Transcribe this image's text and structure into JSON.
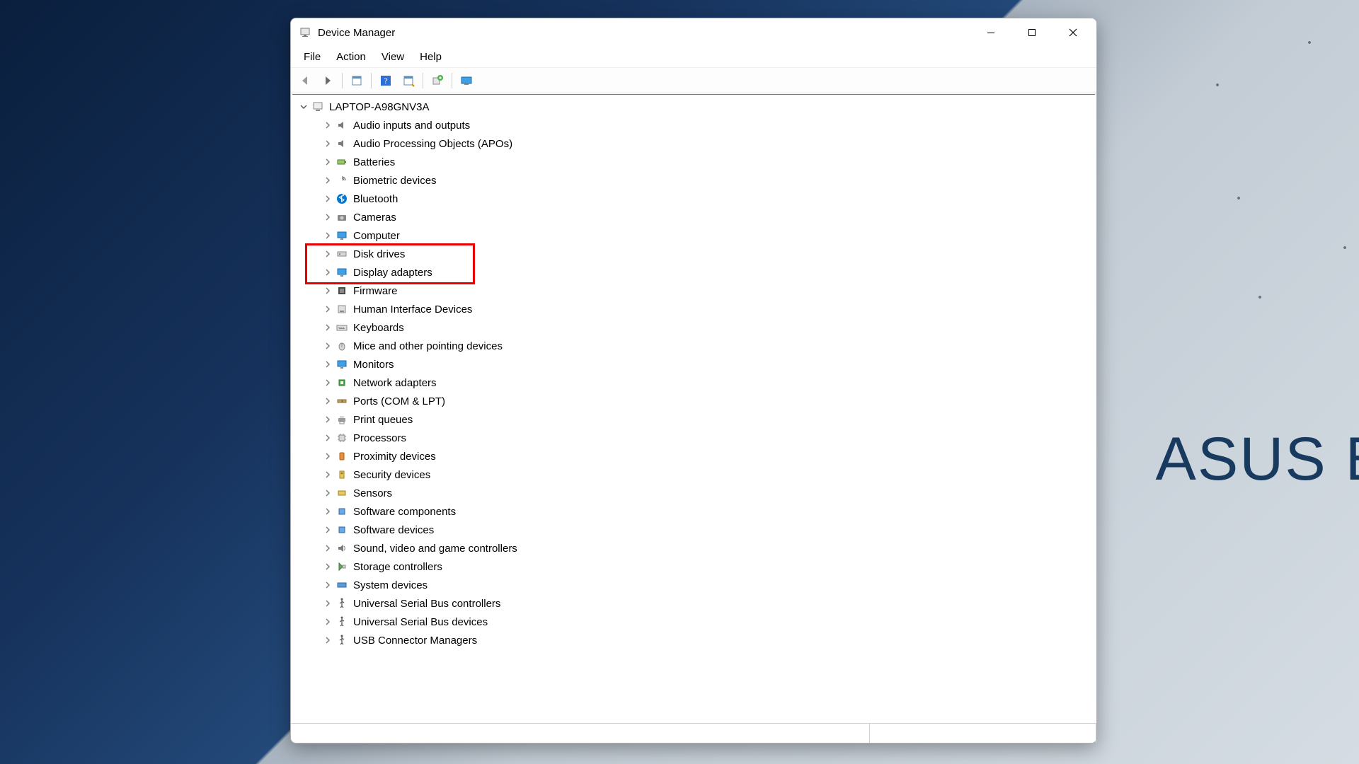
{
  "desktop": {
    "brand_text": "ASUS E"
  },
  "window": {
    "title": "Device Manager",
    "menu": {
      "file": "File",
      "action": "Action",
      "view": "View",
      "help": "Help"
    },
    "toolbar": {
      "back": "back-icon",
      "forward": "forward-icon",
      "show_hidden": "show-hidden-icon",
      "help": "help-icon",
      "properties": "properties-icon",
      "update": "update-driver-icon",
      "scan": "scan-hardware-icon"
    }
  },
  "tree": {
    "root": {
      "label": "LAPTOP-A98GNV3A",
      "expanded": true
    },
    "items": [
      {
        "label": "Audio inputs and outputs",
        "icon": "audio-icon"
      },
      {
        "label": "Audio Processing Objects (APOs)",
        "icon": "audio-icon"
      },
      {
        "label": "Batteries",
        "icon": "battery-icon"
      },
      {
        "label": "Biometric devices",
        "icon": "biometric-icon"
      },
      {
        "label": "Bluetooth",
        "icon": "bluetooth-icon"
      },
      {
        "label": "Cameras",
        "icon": "camera-icon"
      },
      {
        "label": "Computer",
        "icon": "computer-icon"
      },
      {
        "label": "Disk drives",
        "icon": "disk-icon",
        "highlight": true
      },
      {
        "label": "Display adapters",
        "icon": "display-icon",
        "highlight": true
      },
      {
        "label": "Firmware",
        "icon": "firmware-icon"
      },
      {
        "label": "Human Interface Devices",
        "icon": "hid-icon"
      },
      {
        "label": "Keyboards",
        "icon": "keyboard-icon"
      },
      {
        "label": "Mice and other pointing devices",
        "icon": "mouse-icon"
      },
      {
        "label": "Monitors",
        "icon": "monitor-icon"
      },
      {
        "label": "Network adapters",
        "icon": "network-icon"
      },
      {
        "label": "Ports (COM & LPT)",
        "icon": "ports-icon"
      },
      {
        "label": "Print queues",
        "icon": "printer-icon"
      },
      {
        "label": "Processors",
        "icon": "processor-icon"
      },
      {
        "label": "Proximity devices",
        "icon": "proximity-icon"
      },
      {
        "label": "Security devices",
        "icon": "security-icon"
      },
      {
        "label": "Sensors",
        "icon": "sensor-icon"
      },
      {
        "label": "Software components",
        "icon": "software-comp-icon"
      },
      {
        "label": "Software devices",
        "icon": "software-dev-icon"
      },
      {
        "label": "Sound, video and game controllers",
        "icon": "sound-icon"
      },
      {
        "label": "Storage controllers",
        "icon": "storage-icon"
      },
      {
        "label": "System devices",
        "icon": "system-icon"
      },
      {
        "label": "Universal Serial Bus controllers",
        "icon": "usb-icon"
      },
      {
        "label": "Universal Serial Bus devices",
        "icon": "usb-icon"
      },
      {
        "label": "USB Connector Managers",
        "icon": "usb-icon"
      }
    ]
  },
  "colors": {
    "highlight": "#e60000",
    "bt": "#0078d4"
  }
}
